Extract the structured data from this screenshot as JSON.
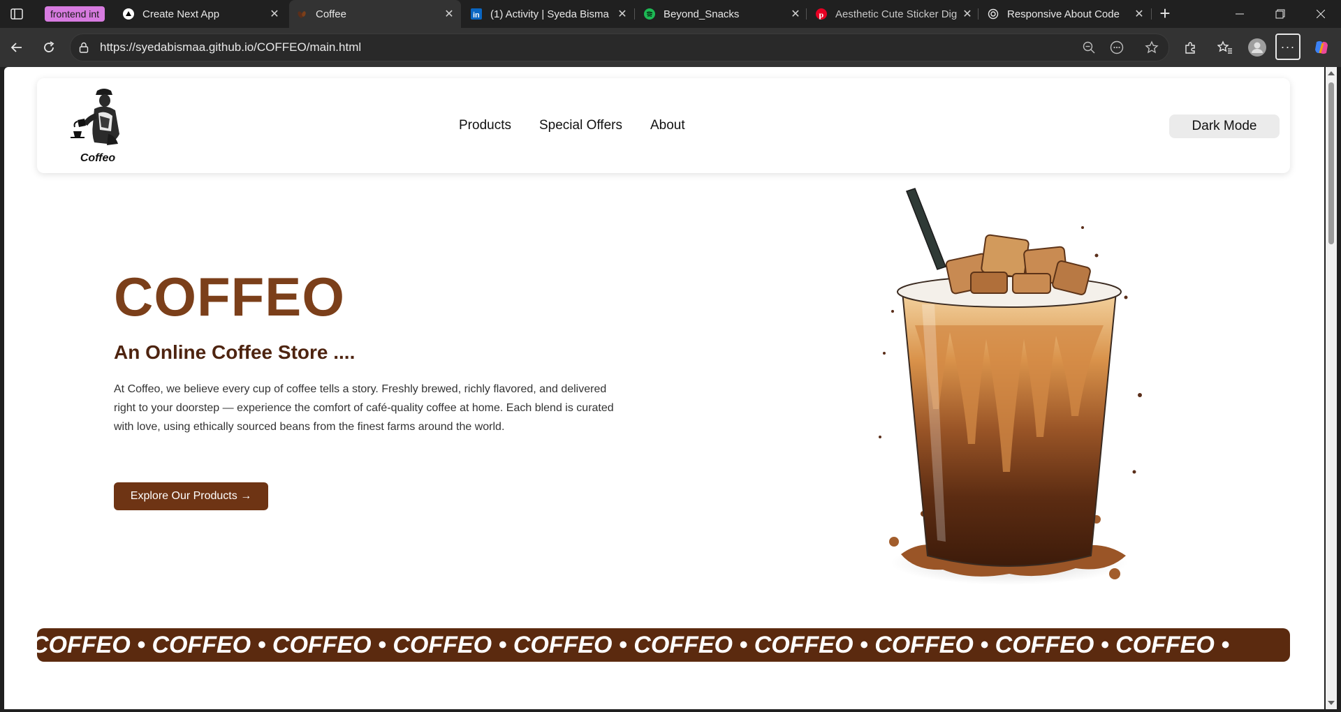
{
  "browser": {
    "tab_group_label": "frontend int",
    "tabs": [
      {
        "title": "Create Next App",
        "favicon": "triangle-icon",
        "active": false
      },
      {
        "title": "Coffee",
        "favicon": "coffee-bean-icon",
        "active": true
      },
      {
        "title": "(1) Activity | Syeda Bisma",
        "favicon": "linkedin-icon",
        "active": false
      },
      {
        "title": "Beyond_Snacks",
        "favicon": "spotify-icon",
        "active": false
      },
      {
        "title": "Aesthetic Cute Sticker Dig",
        "favicon": "pinterest-icon",
        "active": false
      },
      {
        "title": "Responsive About Code",
        "favicon": "openai-icon",
        "active": false
      }
    ],
    "url": "https://syedabismaa.github.io/COFFEO/main.html"
  },
  "site": {
    "logo_text": "Coffeo",
    "nav": {
      "links": [
        "Products",
        "Special Offers",
        "About"
      ],
      "dark_mode_label": "Dark Mode"
    },
    "hero": {
      "title": "COFFEO",
      "subtitle": "An Online Coffee Store ....",
      "description": "At Coffeo, we believe every cup of coffee tells a story. Freshly brewed, richly flavored, and delivered right to your doorstep — experience the comfort of café-quality coffee at home. Each blend is curated with love, using ethically sourced beans from the finest farms around the world.",
      "cta_label": "Explore Our Products →"
    },
    "marquee_text": "COFFEO • COFFEO • COFFEO • COFFEO • COFFEO • COFFEO • COFFEO • COFFEO • COFFEO • COFFEO •"
  },
  "colors": {
    "brand_brown": "#7b3f1a",
    "cta_brown": "#6e3414",
    "marquee_brown": "#5b2a0f",
    "tab_group": "#d77be0"
  }
}
